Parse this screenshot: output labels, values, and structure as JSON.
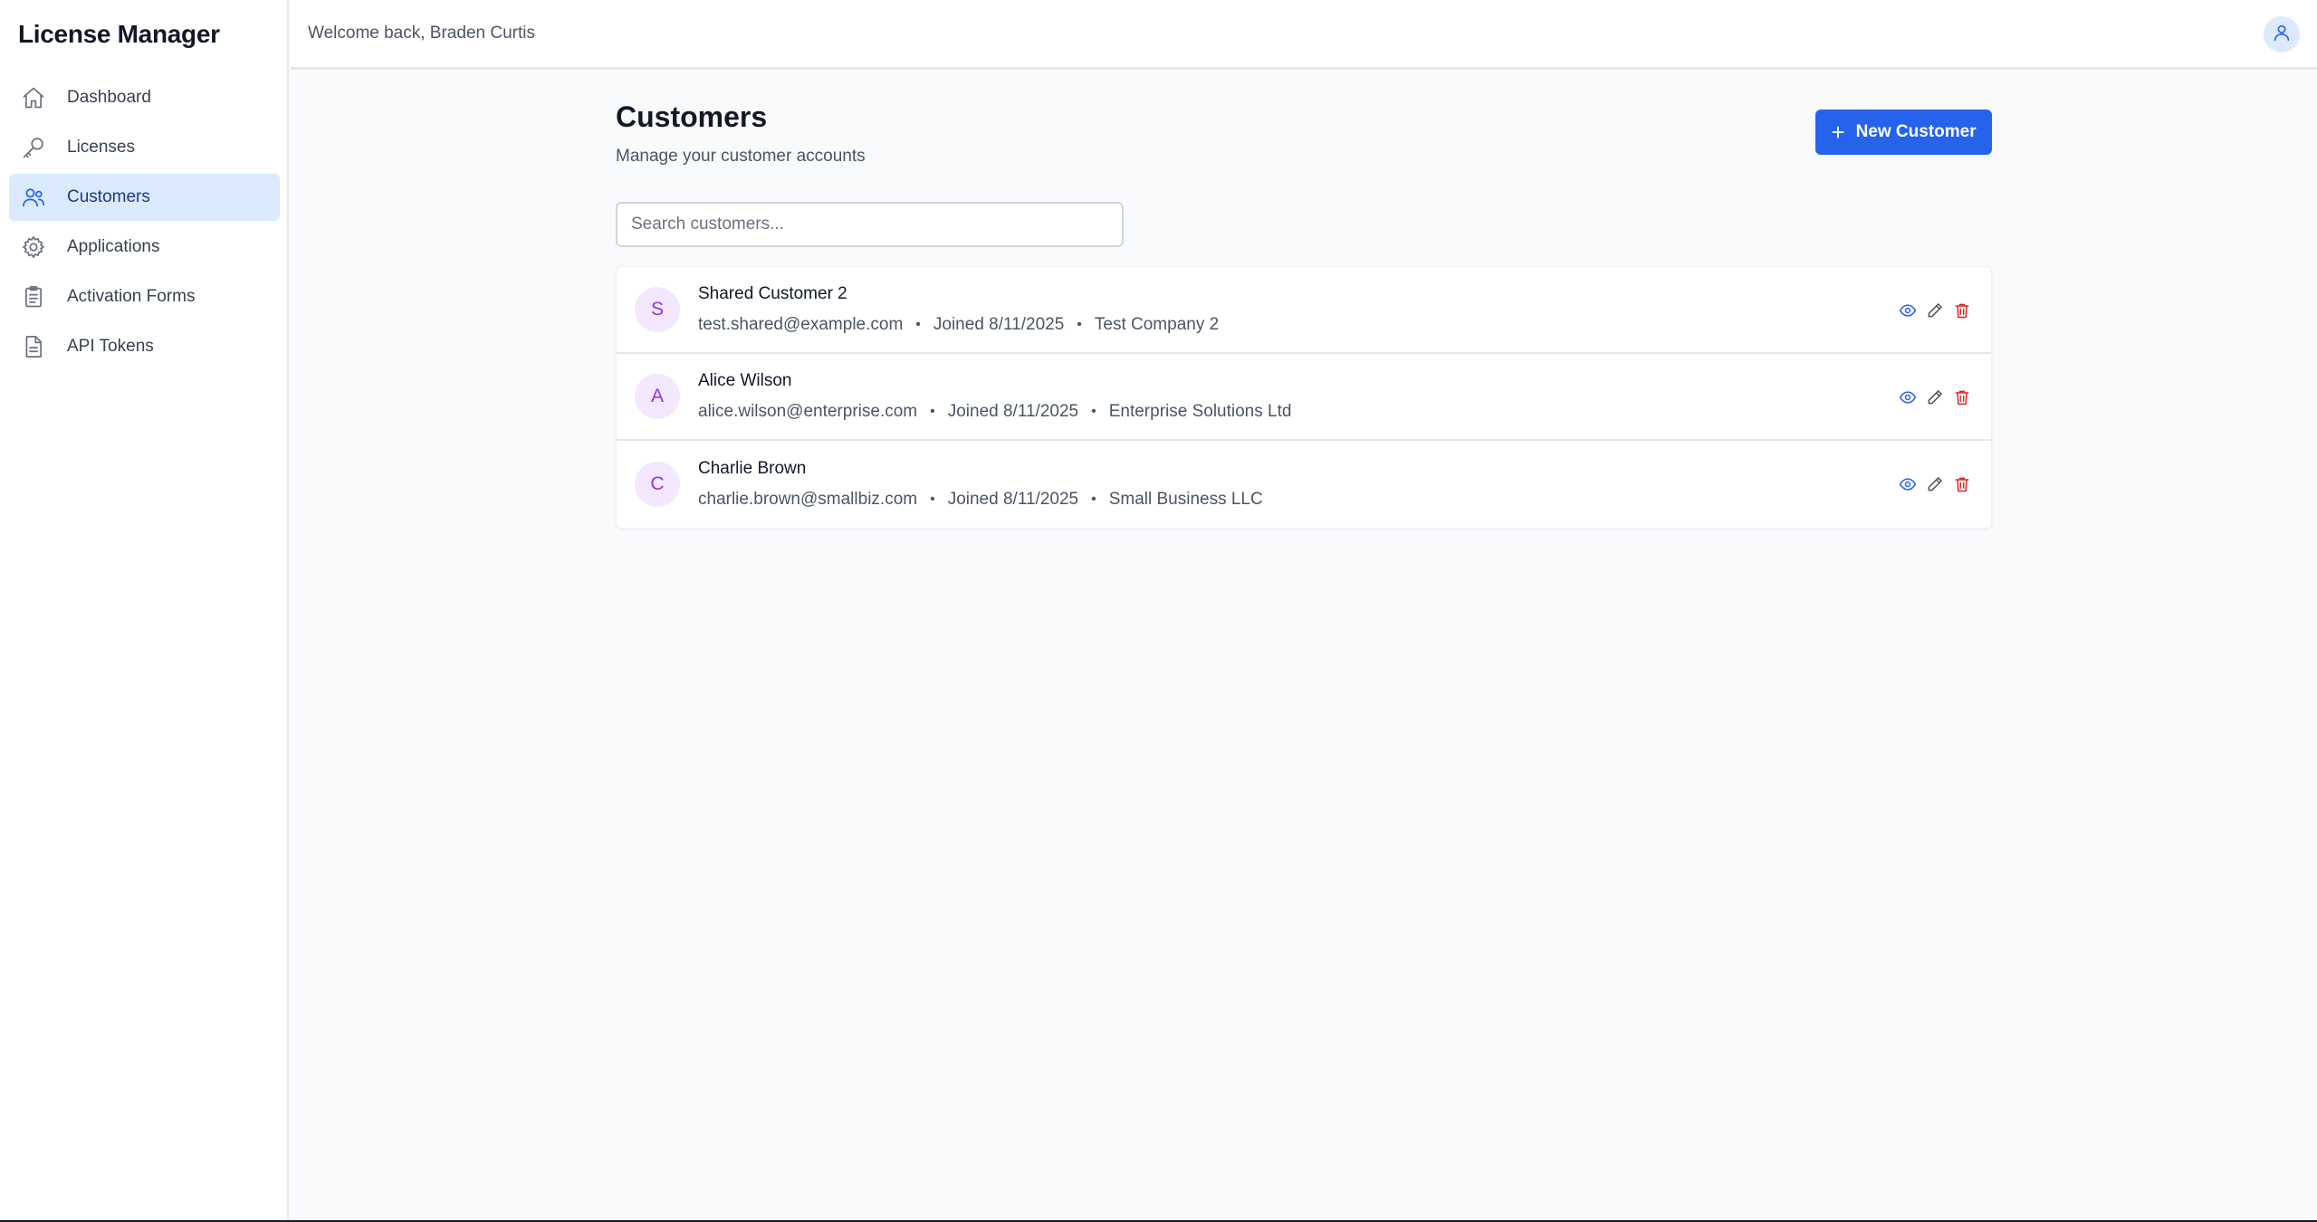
{
  "sidebar": {
    "brand": "License Manager",
    "items": [
      {
        "label": "Dashboard",
        "icon": "home-icon",
        "active": false
      },
      {
        "label": "Licenses",
        "icon": "key-icon",
        "active": false
      },
      {
        "label": "Customers",
        "icon": "users-icon",
        "active": true
      },
      {
        "label": "Applications",
        "icon": "gear-icon",
        "active": false
      },
      {
        "label": "Activation Forms",
        "icon": "clipboard-icon",
        "active": false
      },
      {
        "label": "API Tokens",
        "icon": "document-icon",
        "active": false
      }
    ]
  },
  "header": {
    "welcome": "Welcome back, Braden Curtis",
    "user_icon": "user-icon"
  },
  "page": {
    "title": "Customers",
    "subtitle": "Manage your customer accounts",
    "new_button_label": "New Customer",
    "search_placeholder": "Search customers..."
  },
  "customers": [
    {
      "initial": "S",
      "name": "Shared Customer 2",
      "email": "test.shared@example.com",
      "joined": "Joined 8/11/2025",
      "company": "Test Company 2"
    },
    {
      "initial": "A",
      "name": "Alice Wilson",
      "email": "alice.wilson@enterprise.com",
      "joined": "Joined 8/11/2025",
      "company": "Enterprise Solutions Ltd"
    },
    {
      "initial": "C",
      "name": "Charlie Brown",
      "email": "charlie.brown@smallbiz.com",
      "joined": "Joined 8/11/2025",
      "company": "Small Business LLC"
    }
  ],
  "colors": {
    "accent": "#2563eb",
    "active_nav_bg": "#dbeafe",
    "avatar_bg": "#f3e8ff",
    "avatar_fg": "#9333ea",
    "delete": "#dc2626"
  }
}
